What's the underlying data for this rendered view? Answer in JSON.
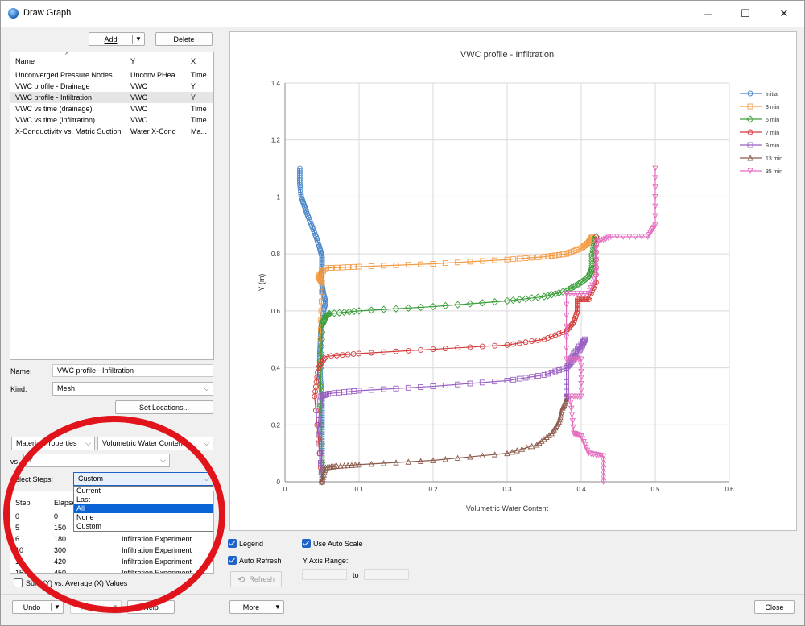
{
  "window": {
    "title": "Draw Graph",
    "minimize": "─",
    "maximize": "☐",
    "close": "✕"
  },
  "toolbar": {
    "add": "Add",
    "delete": "Delete"
  },
  "graph_list": {
    "headers": [
      "Name",
      "Y",
      "X"
    ],
    "rows": [
      [
        "Unconverged Pressure Nodes",
        "Unconv PHea...",
        "Time"
      ],
      [
        "VWC profile - Drainage",
        "VWC",
        "Y"
      ],
      [
        "VWC profile - Infiltration",
        "VWC",
        "Y"
      ],
      [
        "VWC vs time (drainage)",
        "VWC",
        "Time"
      ],
      [
        "VWC vs time (infiltration)",
        "VWC",
        "Time"
      ],
      [
        "X-Conductivity vs. Matric Suction",
        "Water X-Cond",
        "Ma..."
      ]
    ]
  },
  "form": {
    "name_label": "Name:",
    "name_value": "VWC profile - Infiltration",
    "kind_label": "Kind:",
    "kind_value": "Mesh",
    "set_locations": "Set Locations...",
    "category": "Material Properties",
    "quantity": "Volumetric Water Content",
    "vs_label": "vs",
    "vs_value": "Y",
    "select_steps_label": "Select Steps:",
    "select_steps_value": "Custom"
  },
  "steps_dropdown": {
    "options": [
      "Current",
      "Last",
      "All",
      "None",
      "Custom"
    ],
    "highlighted": "All"
  },
  "steps_table": {
    "headers": [
      "Step",
      "Elapsed",
      ""
    ],
    "rows": [
      [
        "0",
        "0",
        ""
      ],
      [
        "5",
        "150",
        ""
      ],
      [
        "6",
        "180",
        "Infiltration Experiment"
      ],
      [
        "10",
        "300",
        "Infiltration Experiment"
      ],
      [
        "14",
        "420",
        "Infiltration Experiment"
      ],
      [
        "15",
        "450",
        "Infiltration Experiment"
      ]
    ]
  },
  "sum_average": "Sum (Y) vs. Average (X) Values",
  "options": {
    "legend": "Legend",
    "auto_refresh": "Auto Refresh",
    "refresh": "Refresh",
    "use_auto_scale": "Use Auto Scale",
    "y_axis_range": "Y Axis Range:",
    "to": "to"
  },
  "footer": {
    "undo": "Undo",
    "redo": "Redo",
    "help": "Help",
    "more": "More",
    "close": "Close"
  },
  "colors": {
    "highlight": "#0a64d6",
    "annotation_circle": "#e2141b"
  },
  "chart_data": {
    "type": "line",
    "title": "VWC profile - Infiltration",
    "xlabel": "Volumetric Water Content",
    "ylabel": "Y (m)",
    "xlim": [
      0,
      0.6
    ],
    "ylim": [
      0,
      1.4
    ],
    "xticks": [
      "0",
      "0.1",
      "0.2",
      "0.3",
      "0.4",
      "0.5",
      "0.6"
    ],
    "yticks": [
      "0",
      "0.2",
      "0.4",
      "0.6",
      "0.8",
      "1",
      "1.2",
      "1.4"
    ],
    "grid": true,
    "legend_position": "top-right",
    "series": [
      {
        "name": "Initial",
        "color": "#4a86c8",
        "marker": "circle",
        "points": [
          [
            0.02,
            1.1
          ],
          [
            0.02,
            1.05
          ],
          [
            0.022,
            1.0
          ],
          [
            0.026,
            0.97
          ],
          [
            0.03,
            0.94
          ],
          [
            0.036,
            0.9
          ],
          [
            0.042,
            0.86
          ],
          [
            0.047,
            0.82
          ],
          [
            0.05,
            0.79
          ],
          [
            0.05,
            0.76
          ],
          [
            0.049,
            0.72
          ],
          [
            0.05,
            0.69
          ],
          [
            0.052,
            0.66
          ],
          [
            0.055,
            0.63
          ],
          [
            0.052,
            0.6
          ],
          [
            0.049,
            0.55
          ],
          [
            0.048,
            0.5
          ],
          [
            0.047,
            0.45
          ],
          [
            0.047,
            0.4
          ],
          [
            0.048,
            0.35
          ],
          [
            0.05,
            0.3
          ],
          [
            0.05,
            0.25
          ],
          [
            0.05,
            0.2
          ],
          [
            0.05,
            0.15
          ],
          [
            0.05,
            0.1
          ],
          [
            0.05,
            0.05
          ],
          [
            0.05,
            0
          ]
        ]
      },
      {
        "name": "3 min",
        "color": "#f39a43",
        "marker": "square",
        "points": [
          [
            0.05,
            0
          ],
          [
            0.048,
            0.5
          ],
          [
            0.05,
            0.7
          ],
          [
            0.045,
            0.72
          ],
          [
            0.055,
            0.75
          ],
          [
            0.1,
            0.755
          ],
          [
            0.2,
            0.765
          ],
          [
            0.3,
            0.78
          ],
          [
            0.35,
            0.79
          ],
          [
            0.38,
            0.8
          ],
          [
            0.4,
            0.82
          ],
          [
            0.41,
            0.84
          ],
          [
            0.415,
            0.86
          ]
        ]
      },
      {
        "name": "5 min",
        "color": "#3a9e3a",
        "marker": "diamond",
        "points": [
          [
            0.05,
            0
          ],
          [
            0.048,
            0.4
          ],
          [
            0.05,
            0.55
          ],
          [
            0.055,
            0.58
          ],
          [
            0.06,
            0.59
          ],
          [
            0.1,
            0.6
          ],
          [
            0.2,
            0.615
          ],
          [
            0.3,
            0.635
          ],
          [
            0.35,
            0.65
          ],
          [
            0.38,
            0.67
          ],
          [
            0.4,
            0.7
          ],
          [
            0.41,
            0.72
          ],
          [
            0.415,
            0.75
          ],
          [
            0.415,
            0.8
          ],
          [
            0.42,
            0.86
          ]
        ]
      },
      {
        "name": "7 min",
        "color": "#d43c3c",
        "marker": "circle",
        "points": [
          [
            0.05,
            0
          ],
          [
            0.04,
            0.3
          ],
          [
            0.045,
            0.4
          ],
          [
            0.055,
            0.44
          ],
          [
            0.1,
            0.45
          ],
          [
            0.2,
            0.465
          ],
          [
            0.3,
            0.48
          ],
          [
            0.35,
            0.5
          ],
          [
            0.38,
            0.53
          ],
          [
            0.39,
            0.56
          ],
          [
            0.395,
            0.6
          ],
          [
            0.395,
            0.64
          ],
          [
            0.41,
            0.64
          ],
          [
            0.42,
            0.7
          ],
          [
            0.42,
            0.86
          ]
        ]
      },
      {
        "name": "9 min",
        "color": "#9a5fc2",
        "marker": "square",
        "points": [
          [
            0.05,
            0
          ],
          [
            0.045,
            0.2
          ],
          [
            0.048,
            0.3
          ],
          [
            0.06,
            0.31
          ],
          [
            0.1,
            0.32
          ],
          [
            0.2,
            0.335
          ],
          [
            0.3,
            0.355
          ],
          [
            0.35,
            0.375
          ],
          [
            0.38,
            0.4
          ],
          [
            0.39,
            0.43
          ],
          [
            0.4,
            0.47
          ],
          [
            0.405,
            0.5
          ],
          [
            0.39,
            0.45
          ],
          [
            0.38,
            0.4
          ],
          [
            0.38,
            0.3
          ],
          [
            0.38,
            0.29
          ]
        ]
      },
      {
        "name": "13 min",
        "color": "#8b5a4a",
        "marker": "triangle",
        "points": [
          [
            0.05,
            0
          ],
          [
            0.055,
            0.05
          ],
          [
            0.07,
            0.055
          ],
          [
            0.1,
            0.06
          ],
          [
            0.2,
            0.075
          ],
          [
            0.3,
            0.1
          ],
          [
            0.34,
            0.13
          ],
          [
            0.36,
            0.17
          ],
          [
            0.37,
            0.21
          ],
          [
            0.375,
            0.26
          ],
          [
            0.38,
            0.29
          ]
        ]
      },
      {
        "name": "35 min",
        "color": "#e56cc1",
        "marker": "triangle-down",
        "points": [
          [
            0.43,
            0
          ],
          [
            0.43,
            0.09
          ],
          [
            0.41,
            0.1
          ],
          [
            0.4,
            0.16
          ],
          [
            0.39,
            0.17
          ],
          [
            0.385,
            0.3
          ],
          [
            0.4,
            0.3
          ],
          [
            0.4,
            0.43
          ],
          [
            0.38,
            0.43
          ],
          [
            0.38,
            0.66
          ],
          [
            0.41,
            0.66
          ],
          [
            0.42,
            0.72
          ],
          [
            0.42,
            0.84
          ],
          [
            0.44,
            0.86
          ],
          [
            0.49,
            0.86
          ],
          [
            0.5,
            0.9
          ],
          [
            0.5,
            1.1
          ]
        ]
      }
    ]
  }
}
